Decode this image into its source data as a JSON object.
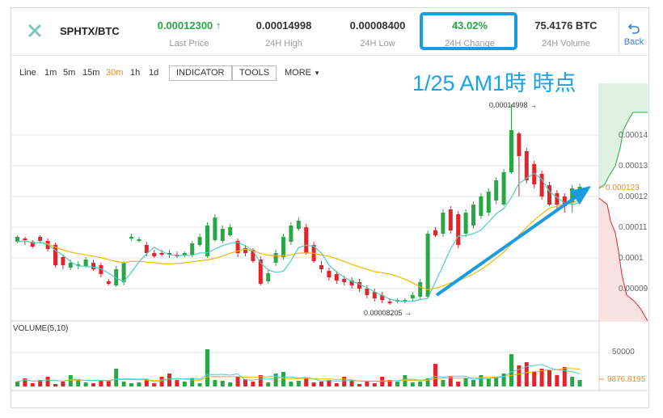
{
  "header": {
    "pair": "SPHTX/BTC",
    "stats": [
      {
        "value": "0.00012300",
        "arrow": "↑",
        "label": "Last Price"
      },
      {
        "value": "0.00014998",
        "label": "24H High"
      },
      {
        "value": "0.00008400",
        "label": "24H Low"
      },
      {
        "value": "43.02%",
        "label": "24H Change"
      },
      {
        "value": "75.4176 BTC",
        "label": "24H Volume"
      }
    ],
    "back_label": "Back"
  },
  "toolbar": {
    "intervals": [
      "Line",
      "1m",
      "5m",
      "15m",
      "30m",
      "1h",
      "1d"
    ],
    "active_interval": "30m",
    "indicator_label": "INDICATOR",
    "tools_label": "TOOLS",
    "more_label": "MORE"
  },
  "annotation": "1/25 AM1時 時点",
  "colors": {
    "up": "#27a845",
    "down": "#e0262b",
    "accent": "#f08a24",
    "ma_fast": "#4ecdc4",
    "ma_slow": "#f5b800",
    "highlight": "#1d9be0"
  },
  "chart_data": [
    {
      "type": "candlestick",
      "price_ticks": [
        "0.00014",
        "0.00013",
        "0.00012",
        "0.00011",
        "0.0001",
        "0.00009"
      ],
      "current_price_label": "0.000123",
      "high_label": "0.00014998",
      "low_label": "0.00008205",
      "ylim": [
        8.1e-05,
        0.0001575
      ]
    },
    {
      "type": "bar",
      "title": "VOLUME(5,10)",
      "tick_label": "50000",
      "current_volume_label": "9876.8195"
    }
  ]
}
